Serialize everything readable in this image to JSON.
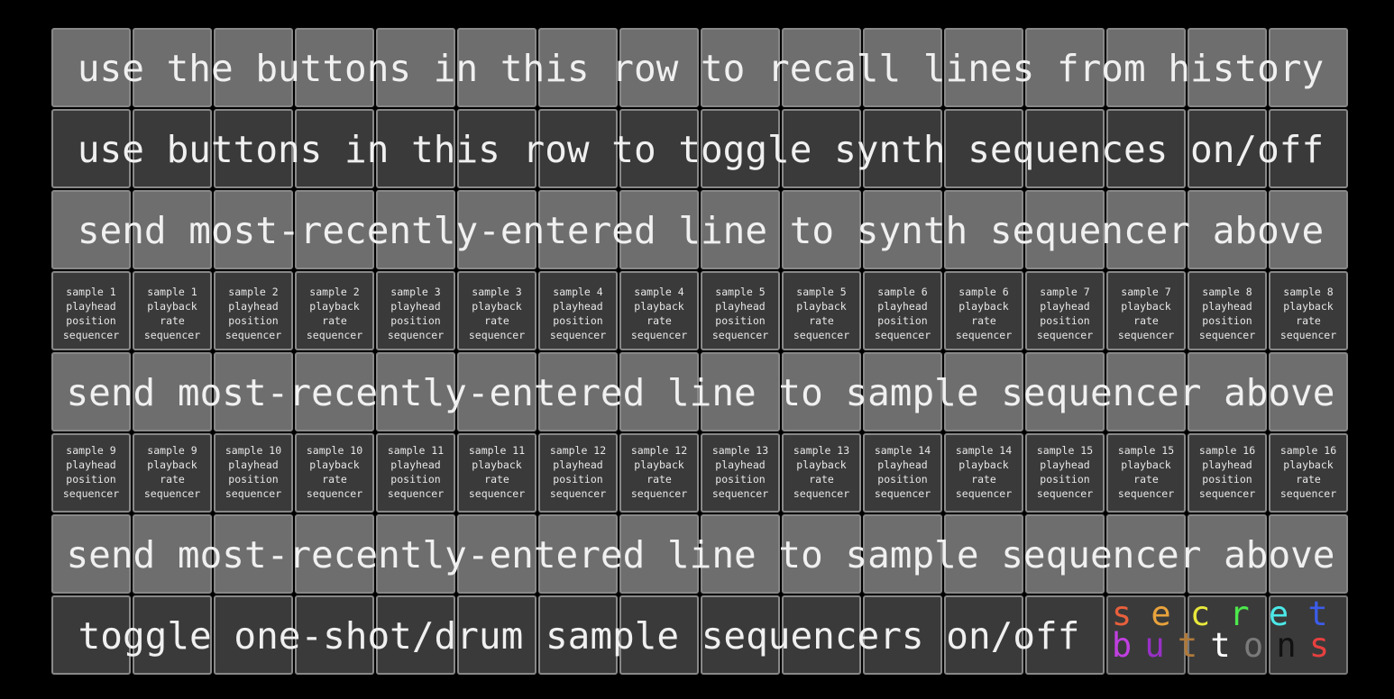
{
  "rows": {
    "history": "use the buttons in this row to recall lines from history",
    "synth_toggle": "use buttons in this row to toggle synth sequences on/off",
    "send_synth": "send most-recently-entered line to synth sequencer above",
    "send_sample_a": "send most-recently-entered line to sample sequencer above",
    "send_sample_b": "send most-recently-entered line to sample sequencer above",
    "drum_toggle": "toggle one-shot/drum sample sequencers on/off"
  },
  "sequencers_top": [
    [
      "sample 1",
      "playhead",
      "position",
      "sequencer"
    ],
    [
      "sample 1",
      "playback",
      "rate",
      "sequencer"
    ],
    [
      "sample 2",
      "playhead",
      "position",
      "sequencer"
    ],
    [
      "sample 2",
      "playback",
      "rate",
      "sequencer"
    ],
    [
      "sample 3",
      "playhead",
      "position",
      "sequencer"
    ],
    [
      "sample 3",
      "playback",
      "rate",
      "sequencer"
    ],
    [
      "sample 4",
      "playhead",
      "position",
      "sequencer"
    ],
    [
      "sample 4",
      "playback",
      "rate",
      "sequencer"
    ],
    [
      "sample 5",
      "playhead",
      "position",
      "sequencer"
    ],
    [
      "sample 5",
      "playback",
      "rate",
      "sequencer"
    ],
    [
      "sample 6",
      "playhead",
      "position",
      "sequencer"
    ],
    [
      "sample 6",
      "playback",
      "rate",
      "sequencer"
    ],
    [
      "sample 7",
      "playhead",
      "position",
      "sequencer"
    ],
    [
      "sample 7",
      "playback",
      "rate",
      "sequencer"
    ],
    [
      "sample 8",
      "playhead",
      "position",
      "sequencer"
    ],
    [
      "sample 8",
      "playback",
      "rate",
      "sequencer"
    ]
  ],
  "sequencers_bottom": [
    [
      "sample 9",
      "playhead",
      "position",
      "sequencer"
    ],
    [
      "sample 9",
      "playback",
      "rate",
      "sequencer"
    ],
    [
      "sample 10",
      "playhead",
      "position",
      "sequencer"
    ],
    [
      "sample 10",
      "playback",
      "rate",
      "sequencer"
    ],
    [
      "sample 11",
      "playhead",
      "position",
      "sequencer"
    ],
    [
      "sample 11",
      "playback",
      "rate",
      "sequencer"
    ],
    [
      "sample 12",
      "playhead",
      "position",
      "sequencer"
    ],
    [
      "sample 12",
      "playback",
      "rate",
      "sequencer"
    ],
    [
      "sample 13",
      "playhead",
      "position",
      "sequencer"
    ],
    [
      "sample 13",
      "playback",
      "rate",
      "sequencer"
    ],
    [
      "sample 14",
      "playhead",
      "position",
      "sequencer"
    ],
    [
      "sample 14",
      "playback",
      "rate",
      "sequencer"
    ],
    [
      "sample 15",
      "playhead",
      "position",
      "sequencer"
    ],
    [
      "sample 15",
      "playback",
      "rate",
      "sequencer"
    ],
    [
      "sample 16",
      "playhead",
      "position",
      "sequencer"
    ],
    [
      "sample 16",
      "playback",
      "rate",
      "sequencer"
    ]
  ],
  "secret_buttons": {
    "top": [
      {
        "char": "s",
        "color": "#e8603c"
      },
      {
        "char": "e",
        "color": "#e8a33c"
      },
      {
        "char": "c",
        "color": "#e8e83c"
      },
      {
        "char": "r",
        "color": "#4ce84c"
      },
      {
        "char": "e",
        "color": "#4ce8e8"
      },
      {
        "char": "t",
        "color": "#3c5ce8"
      }
    ],
    "bottom": [
      {
        "char": "b",
        "color": "#c040e0"
      },
      {
        "char": "u",
        "color": "#9a30c8"
      },
      {
        "char": "t",
        "color": "#b07a3a"
      },
      {
        "char": "t",
        "color": "#ffffff"
      },
      {
        "char": "o",
        "color": "#7a7a7a"
      },
      {
        "char": "n",
        "color": "#111111"
      },
      {
        "char": "s",
        "color": "#e84040"
      }
    ]
  },
  "colors": {
    "light_button": "#6e6e6e",
    "dark_button": "#3a3a3a",
    "border": "#888888",
    "background": "#000000"
  }
}
